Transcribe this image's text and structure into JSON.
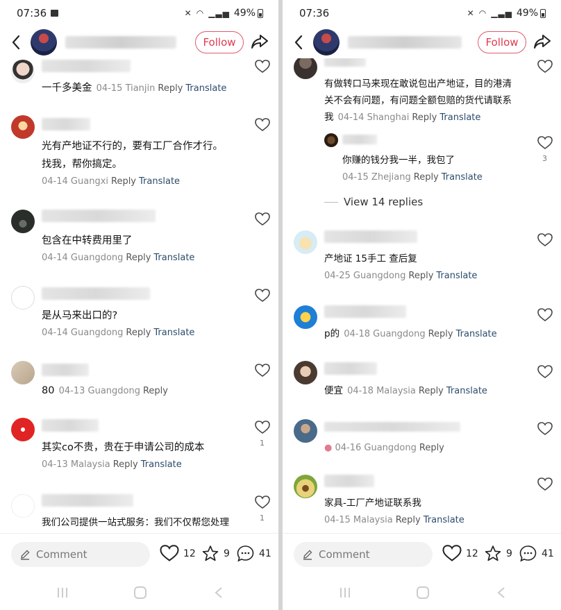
{
  "panels": [
    {
      "status": {
        "time": "07:36",
        "battery": "49%"
      },
      "header": {
        "follow": "Follow"
      },
      "comments": [
        {
          "text": "一千多美金",
          "date": "04-15",
          "location": "Tianjin",
          "reply": "Reply",
          "translate": "Translate"
        },
        {
          "lines": [
            "光有产地证不行的，要有工厂合作才行。",
            "找我，帮你搞定。"
          ],
          "date": "04-14",
          "location": "Guangxi",
          "reply": "Reply",
          "translate": "Translate"
        },
        {
          "text": "包含在中转费用里了",
          "date": "04-14",
          "location": "Guangdong",
          "reply": "Reply",
          "translate": "Translate"
        },
        {
          "text": "是从马来出口的?",
          "date": "04-14",
          "location": "Guangdong",
          "reply": "Reply",
          "translate": "Translate"
        },
        {
          "text": "80",
          "date": "04-13",
          "location": "Guangdong",
          "reply": "Reply"
        },
        {
          "text": "其实co不贵，贵在于申请公司的成本",
          "date": "04-13",
          "location": "Malaysia",
          "reply": "Reply",
          "translate": "Translate",
          "likes": "1"
        },
        {
          "text": "我们公司提供一站式服务：我们不仅帮您处理",
          "likes": "1"
        }
      ],
      "bottom": {
        "comment_placeholder": "Comment",
        "likes": "12",
        "stars": "9",
        "comments": "41"
      }
    },
    {
      "status": {
        "time": "07:36",
        "battery": "49%"
      },
      "header": {
        "follow": "Follow"
      },
      "comments": [
        {
          "lines": [
            "有做转口马来现在敢说包出产地证，目的港清",
            "关不会有问题，有问题全额包赔的货代请联系",
            "我"
          ],
          "date": "04-14",
          "location": "Shanghai",
          "reply": "Reply",
          "translate": "Translate"
        },
        {
          "text": "你赚的钱分我一半，我包了",
          "date": "04-15",
          "location": "Zhejiang",
          "reply": "Reply",
          "translate": "Translate",
          "likes": "3"
        },
        {
          "view_replies": "View 14 replies"
        },
        {
          "text": "产地证 15手工 查后复",
          "date": "04-25",
          "location": "Guangdong",
          "reply": "Reply",
          "translate": "Translate"
        },
        {
          "text": "p的",
          "date": "04-18",
          "location": "Guangdong",
          "reply": "Reply",
          "translate": "Translate"
        },
        {
          "text": "便宜",
          "date": "04-18",
          "location": "Malaysia",
          "reply": "Reply",
          "translate": "Translate"
        },
        {
          "date": "04-16",
          "location": "Guangdong",
          "reply": "Reply"
        },
        {
          "text": "家具-工厂产地证联系我",
          "date": "04-15",
          "location": "Malaysia",
          "reply": "Reply",
          "translate": "Translate"
        }
      ],
      "bottom": {
        "comment_placeholder": "Comment",
        "likes": "12",
        "stars": "9",
        "comments": "41"
      }
    }
  ],
  "icons": [
    "back-icon",
    "share-icon",
    "heart-icon",
    "star-icon",
    "comment-bubble-icon",
    "pencil-icon",
    "recents-nav-icon",
    "home-nav-icon",
    "back-nav-icon",
    "mute-icon",
    "wifi-icon",
    "signal-icon",
    "battery-icon",
    "image-icon"
  ],
  "colors": {
    "follow": "#e0394d",
    "translate": "#2b4b6b",
    "meta": "#8a8a8a"
  }
}
